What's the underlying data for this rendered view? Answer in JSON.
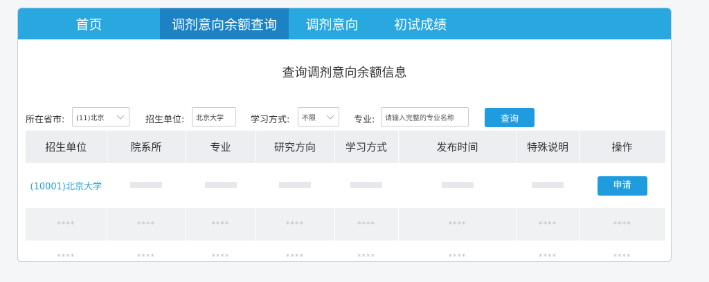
{
  "tabs": [
    {
      "label": "首页"
    },
    {
      "label": "调剂意向余额查询"
    },
    {
      "label": "调剂意向"
    },
    {
      "label": "初试成绩"
    }
  ],
  "title": "查询调剂意向余额信息",
  "filters": {
    "province_label": "所在省市:",
    "province_value": "(11)北京",
    "unit_label": "招生单位:",
    "unit_value": "北京大学",
    "mode_label": "学习方式:",
    "mode_value": "不限",
    "major_label": "专业:",
    "major_placeholder": "请输入完整的专业名称",
    "query_button": "查询"
  },
  "table": {
    "headers": [
      "招生单位",
      "院系所",
      "专业",
      "研究方向",
      "学习方式",
      "发布时间",
      "特殊说明",
      "操作"
    ],
    "row1": {
      "unit": "(10001)北京大学",
      "action": "申请"
    },
    "masked": "****"
  },
  "colors": {
    "accent": "#29a8e0",
    "active_tab": "#1d82c4",
    "button": "#1f9be0"
  }
}
